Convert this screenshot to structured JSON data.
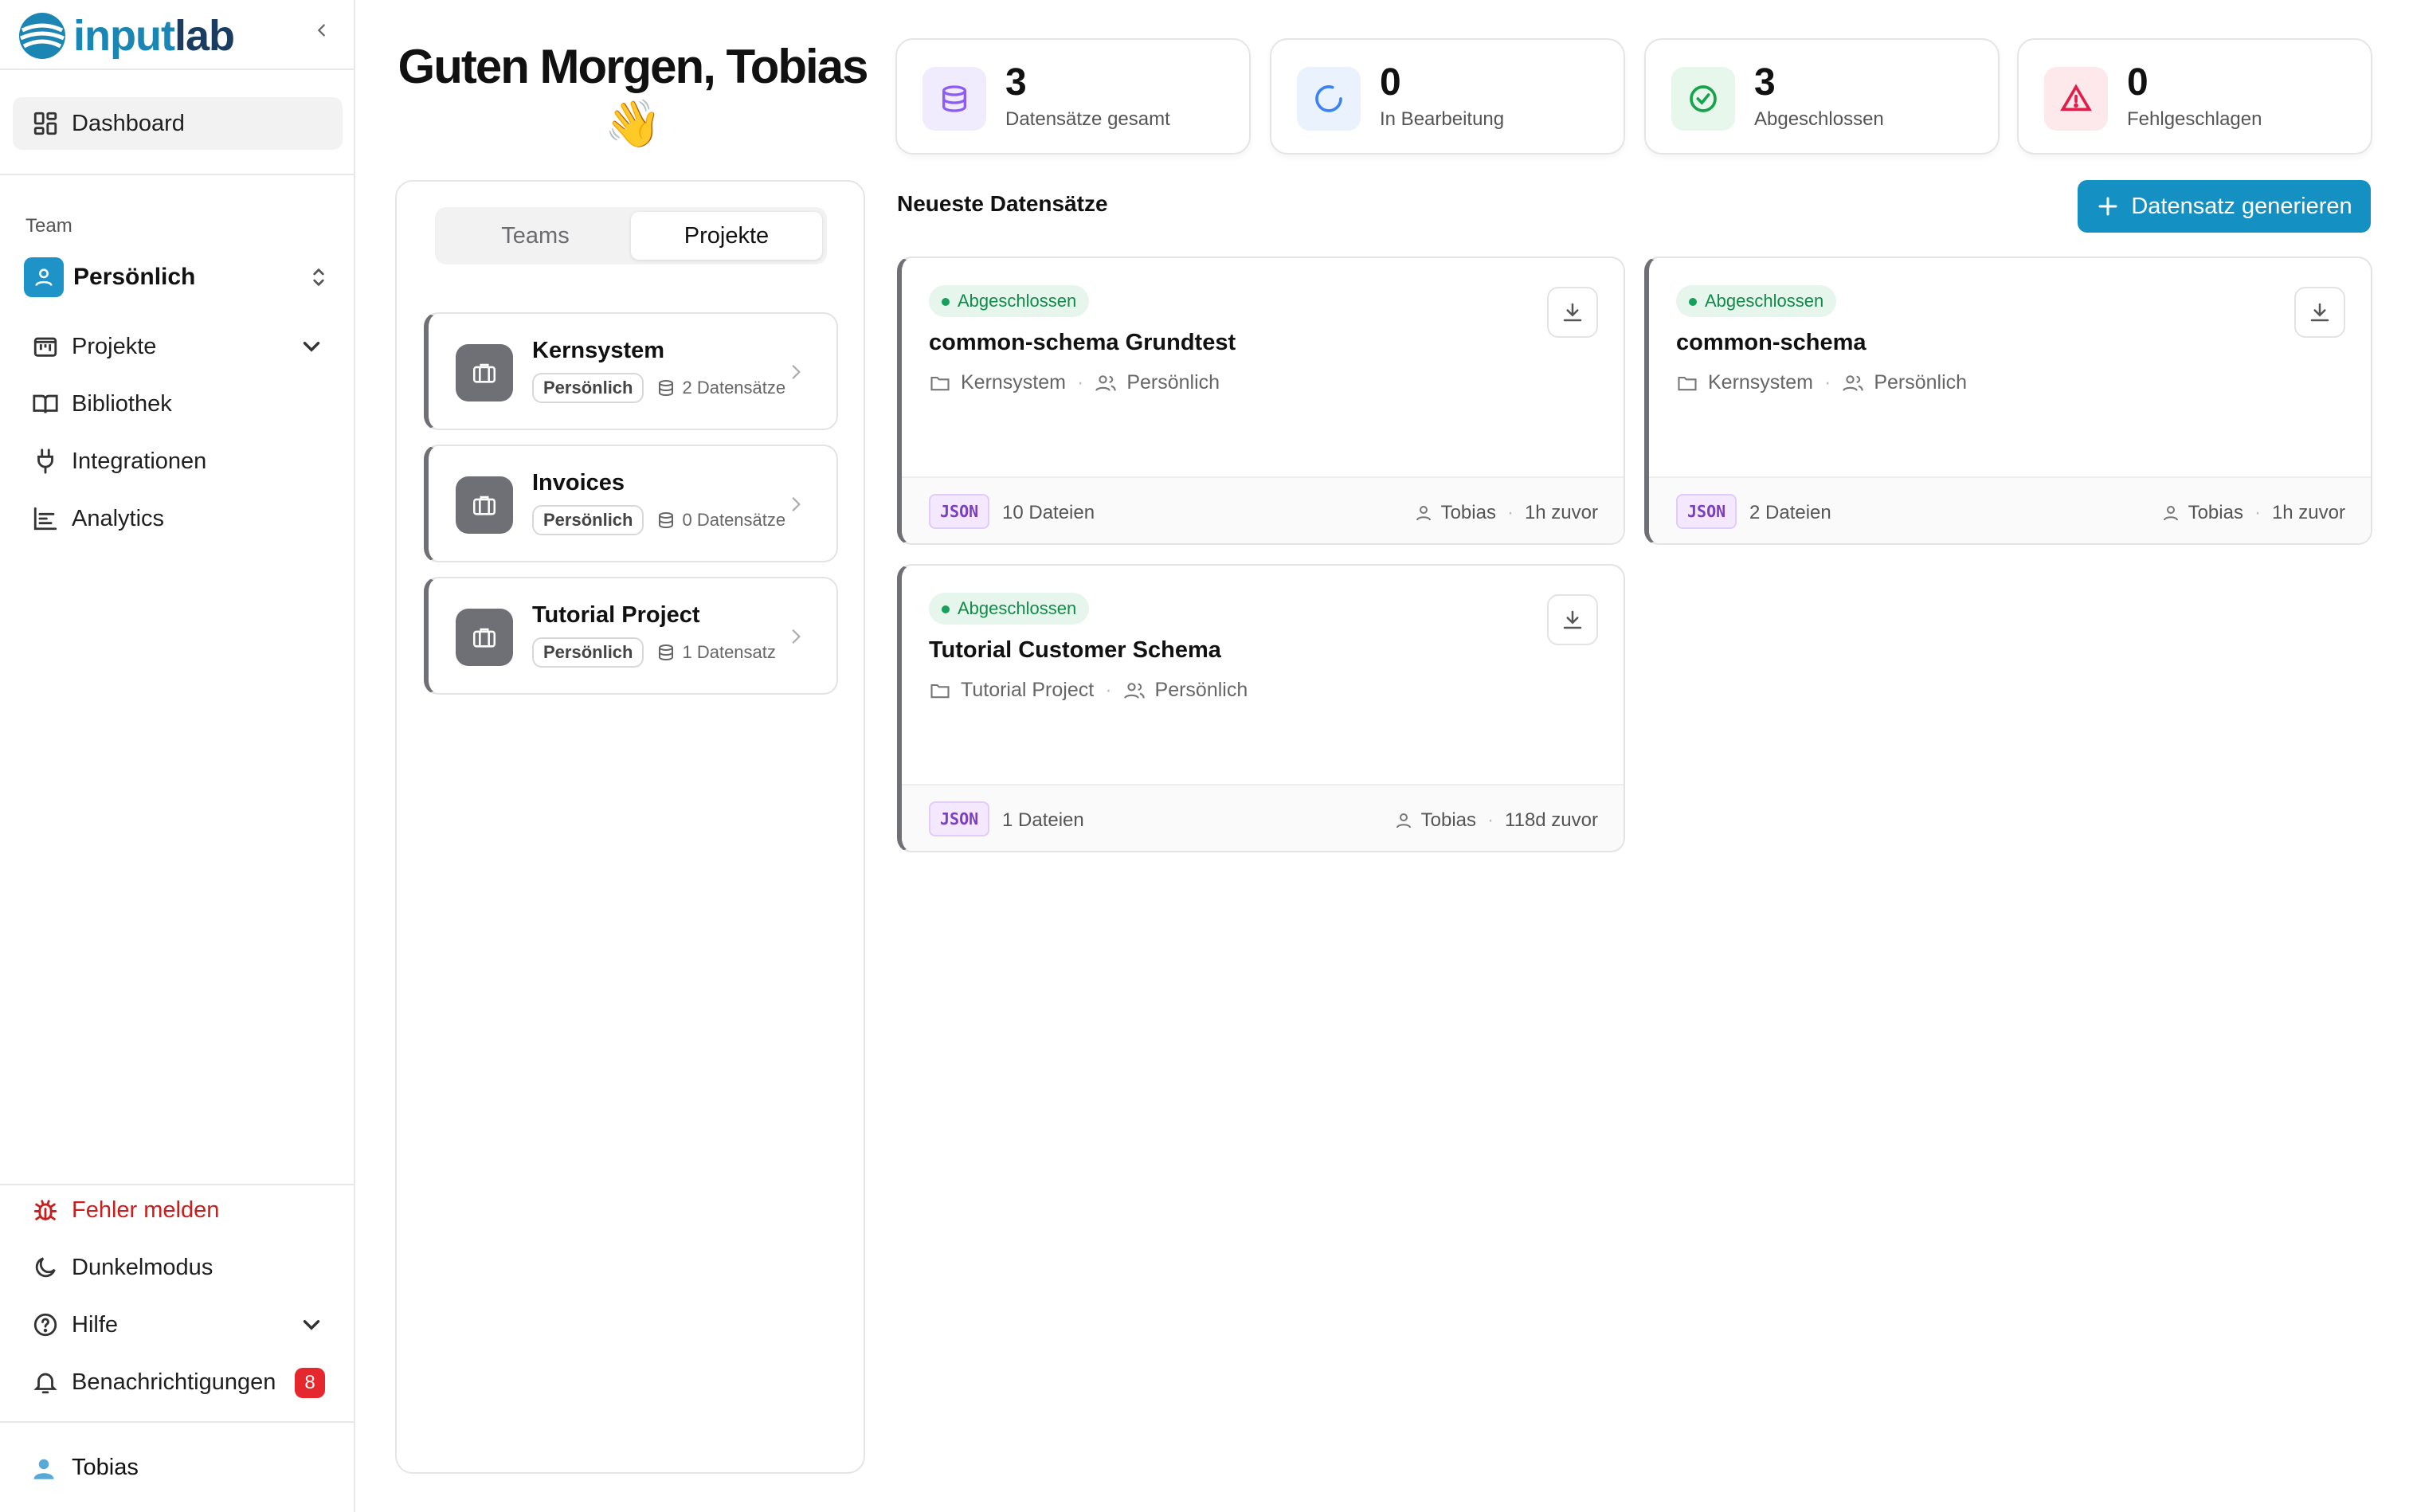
{
  "app": {
    "brand_part1": "input",
    "brand_part2": "lab"
  },
  "sidebar": {
    "dashboard": "Dashboard",
    "team_label": "Team",
    "team_name": "Persönlich",
    "nav": {
      "projects": "Projekte",
      "library": "Bibliothek",
      "integrations": "Integrationen",
      "analytics": "Analytics"
    },
    "bottom": {
      "report_bug": "Fehler melden",
      "dark_mode": "Dunkelmodus",
      "help": "Hilfe",
      "notifications": "Benachrichtigungen",
      "notifications_count": "8"
    },
    "user": "Tobias"
  },
  "greeting": {
    "text": "Guten Morgen, Tobias",
    "emoji": "👋"
  },
  "tabs": {
    "teams": "Teams",
    "projects": "Projekte",
    "active": "projects"
  },
  "projects": [
    {
      "name": "Kernsystem",
      "owner": "Persönlich",
      "count": "2 Datensätze"
    },
    {
      "name": "Invoices",
      "owner": "Persönlich",
      "count": "0 Datensätze"
    },
    {
      "name": "Tutorial Project",
      "owner": "Persönlich",
      "count": "1 Datensatz"
    }
  ],
  "stats": [
    {
      "value": "3",
      "label": "Datensätze gesamt",
      "color": "#8b5cf6",
      "bg": "#f1ebfe",
      "icon": "database-icon"
    },
    {
      "value": "0",
      "label": "In Bearbeitung",
      "color": "#3b82f6",
      "bg": "#eaf2fe",
      "icon": "loader-icon"
    },
    {
      "value": "3",
      "label": "Abgeschlossen",
      "color": "#16a34a",
      "bg": "#e7f7ec",
      "icon": "check-circle-icon"
    },
    {
      "value": "0",
      "label": "Fehlgeschlagen",
      "color": "#e11d48",
      "bg": "#fde8ec",
      "icon": "alert-triangle-icon"
    }
  ],
  "recent": {
    "title": "Neueste Datensätze",
    "generate_button": "Datensatz generieren",
    "items": [
      {
        "status": "Abgeschlossen",
        "name": "common-schema Grundtest",
        "project": "Kernsystem",
        "owner": "Persönlich",
        "format": "JSON",
        "files": "10 Dateien",
        "user": "Tobias",
        "time": "1h zuvor"
      },
      {
        "status": "Abgeschlossen",
        "name": "common-schema",
        "project": "Kernsystem",
        "owner": "Persönlich",
        "format": "JSON",
        "files": "2 Dateien",
        "user": "Tobias",
        "time": "1h zuvor"
      },
      {
        "status": "Abgeschlossen",
        "name": "Tutorial Customer Schema",
        "project": "Tutorial Project",
        "owner": "Persönlich",
        "format": "JSON",
        "files": "1 Dateien",
        "user": "Tobias",
        "time": "118d zuvor"
      }
    ]
  },
  "colors": {
    "accent": "#1590c3",
    "danger": "#c81e1e",
    "success": "#16a05a"
  }
}
